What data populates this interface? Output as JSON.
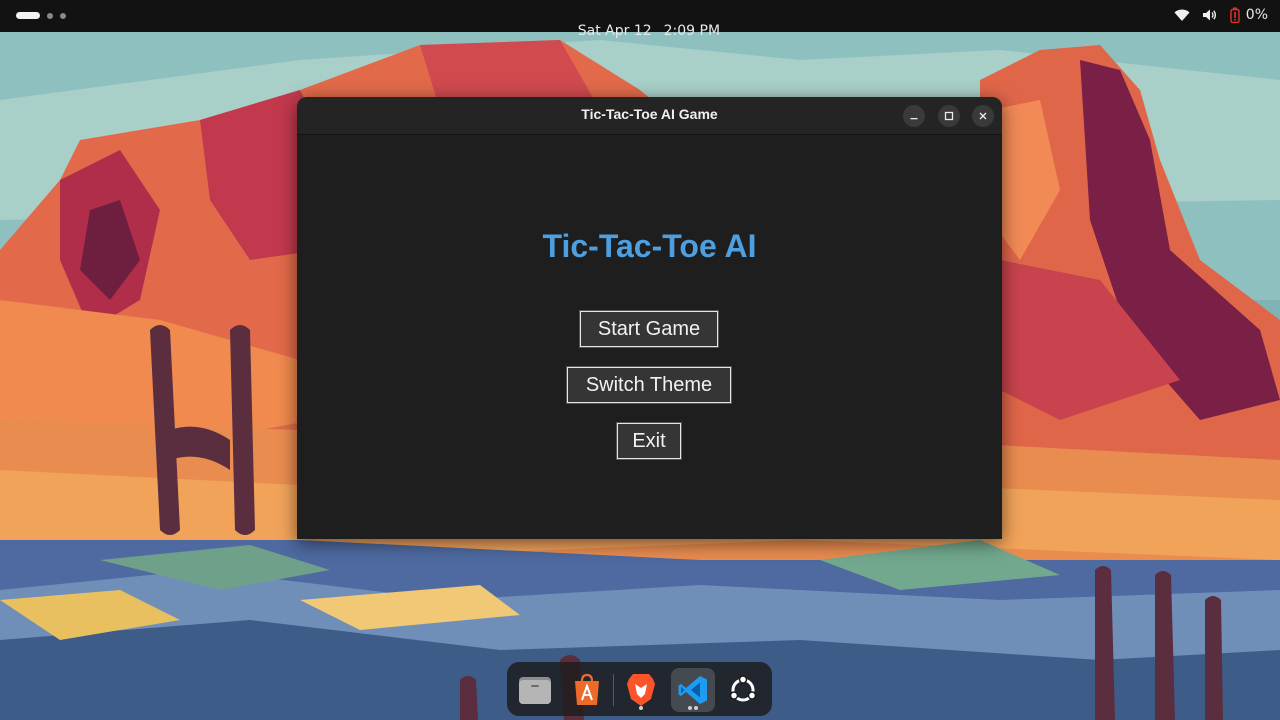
{
  "topbar": {
    "date": "Sat Apr 12",
    "time": "2:09 PM",
    "battery_percent": "0%",
    "icons": [
      "wifi-icon",
      "volume-icon",
      "battery-empty-icon"
    ]
  },
  "window": {
    "title": "Tic-Tac-Toe AI Game",
    "controls": [
      "minimize-icon",
      "maximize-icon",
      "close-icon"
    ]
  },
  "game": {
    "heading": "Tic-Tac-Toe AI",
    "buttons": {
      "start": "Start Game",
      "theme": "Switch Theme",
      "exit": "Exit"
    },
    "colors": {
      "heading": "#4d9fe0",
      "background": "#1e1e1e",
      "button_bg": "#353535",
      "button_border": "#e6e6e6"
    }
  },
  "dock": {
    "apps": [
      "files-icon",
      "app-center-icon",
      "brave-browser-icon",
      "vscode-icon",
      "show-apps-icon"
    ]
  }
}
